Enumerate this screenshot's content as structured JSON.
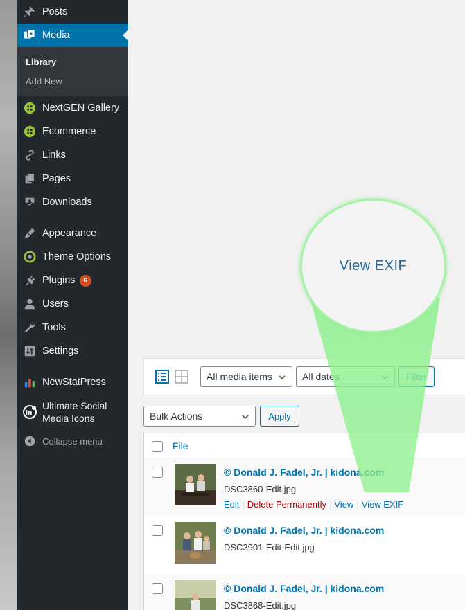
{
  "sidebar": {
    "items": [
      {
        "label": "Posts",
        "icon": "pin-icon"
      },
      {
        "label": "Media",
        "icon": "media-icon",
        "current": true
      },
      {
        "label": "NextGEN Gallery",
        "icon": "nextgen-icon"
      },
      {
        "label": "Ecommerce",
        "icon": "ecommerce-icon"
      },
      {
        "label": "Links",
        "icon": "link-icon"
      },
      {
        "label": "Pages",
        "icon": "pages-icon"
      },
      {
        "label": "Downloads",
        "icon": "download-icon"
      },
      {
        "label": "Appearance",
        "icon": "brush-icon"
      },
      {
        "label": "Theme Options",
        "icon": "theme-options-icon"
      },
      {
        "label": "Plugins",
        "icon": "plugin-icon",
        "badge": "6"
      },
      {
        "label": "Users",
        "icon": "user-icon"
      },
      {
        "label": "Tools",
        "icon": "wrench-icon"
      },
      {
        "label": "Settings",
        "icon": "settings-icon"
      },
      {
        "label": "NewStatPress",
        "icon": "chart-icon"
      },
      {
        "label_line1": "Ultimate Social",
        "label_line2": "Media Icons",
        "icon": "social-icon"
      },
      {
        "label": "Collapse menu",
        "icon": "collapse-icon"
      }
    ],
    "submenu": [
      {
        "label": "Library",
        "active": true
      },
      {
        "label": "Add New"
      }
    ]
  },
  "toolbar": {
    "media_filter": "All media items",
    "date_filter": "All dates",
    "filter_button": "Filter",
    "bulk_actions": "Bulk Actions",
    "apply_button": "Apply"
  },
  "table": {
    "header": "File",
    "rows": [
      {
        "title": "© Donald J. Fadel, Jr. | kidona.com",
        "file": "DSC3860-Edit.jpg",
        "actions": [
          "Edit",
          "Delete Permanently",
          "View",
          "View EXIF"
        ]
      },
      {
        "title": "© Donald J. Fadel, Jr. | kidona.com",
        "file": "DSC3901-Edit-Edit.jpg"
      },
      {
        "title": "© Donald J. Fadel, Jr. | kidona.com",
        "file": "DSC3868-Edit.jpg"
      }
    ]
  },
  "callout": {
    "text": "View EXIF"
  },
  "colors": {
    "sidebar": "#23282d",
    "accent": "#0073aa",
    "badge": "#d54e21",
    "delete": "#a00000",
    "highlight": "#a8f2a8"
  }
}
